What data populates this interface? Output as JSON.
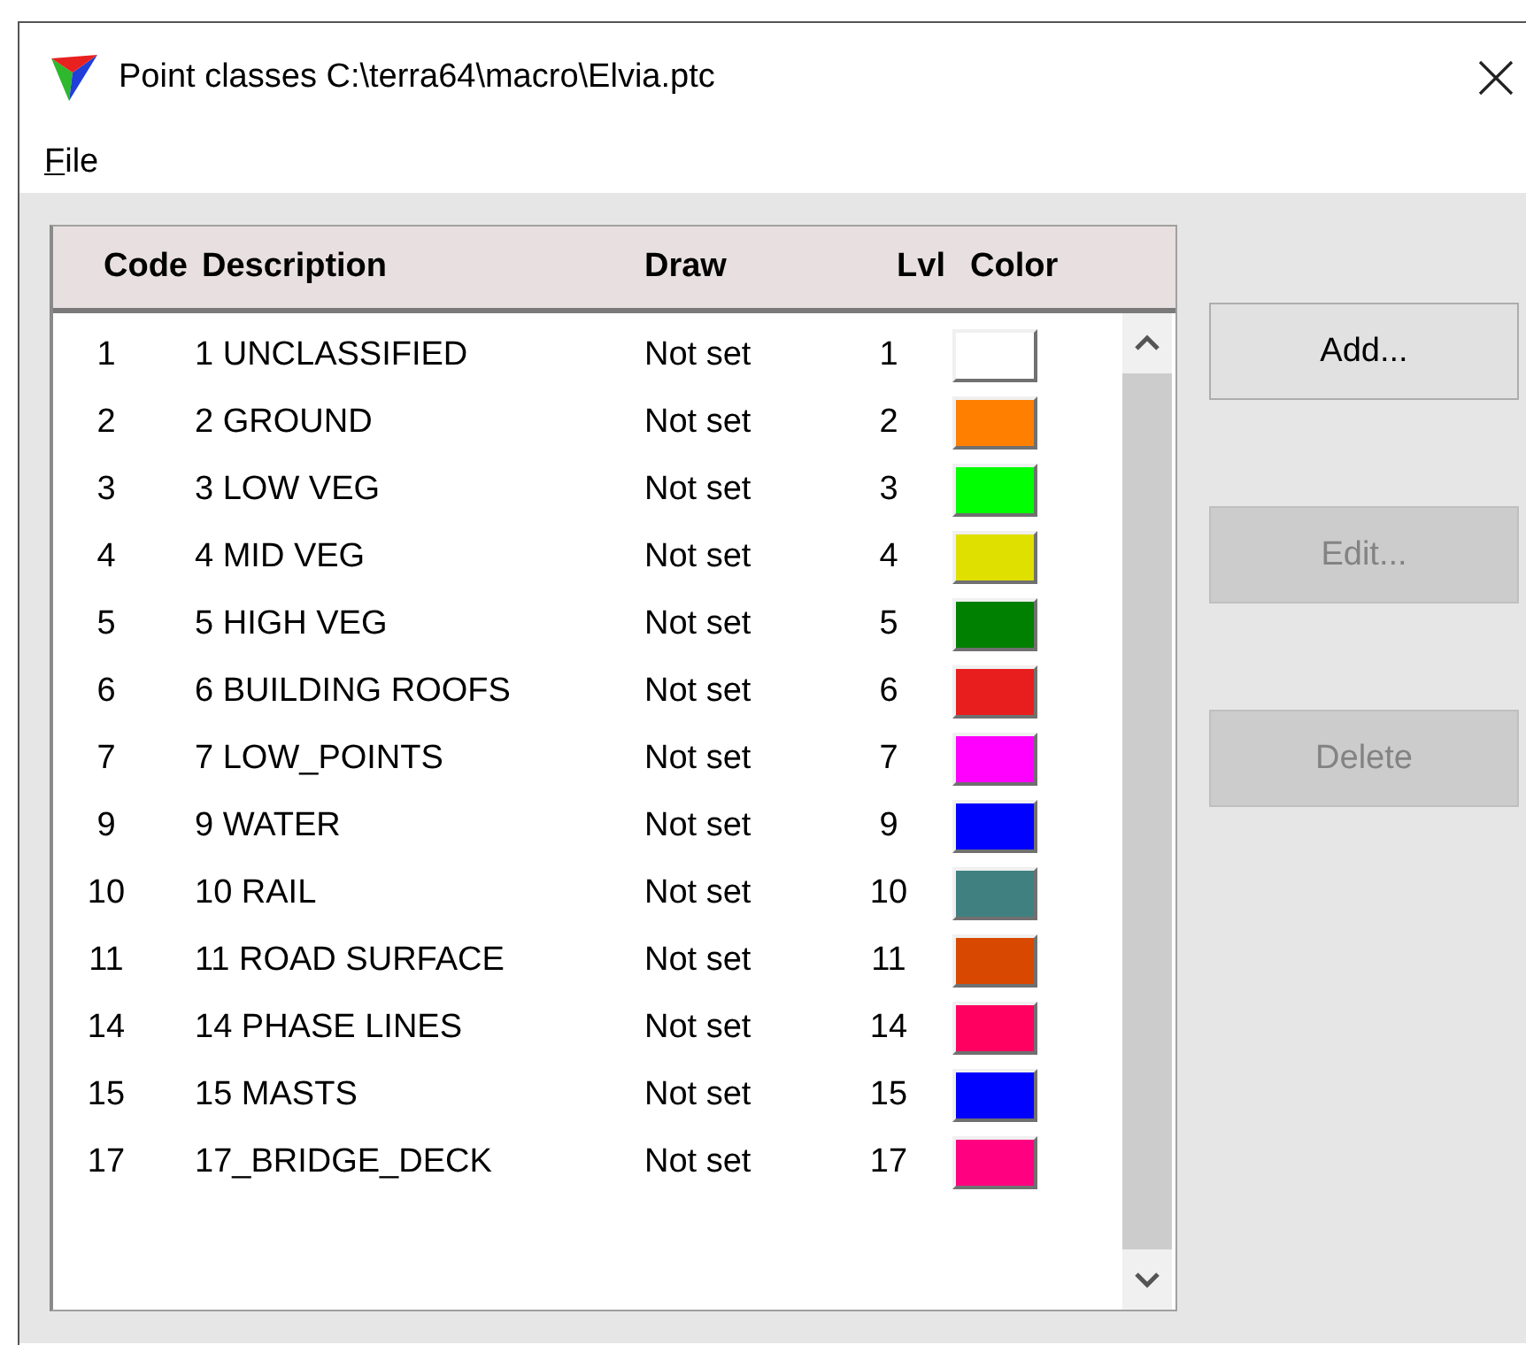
{
  "window": {
    "title": "Point classes C:\\terra64\\macro\\Elvia.ptc"
  },
  "menu": [
    {
      "label": "File"
    }
  ],
  "table": {
    "columns": [
      "Code",
      "Description",
      "Draw",
      "Lvl",
      "Color"
    ],
    "rows": [
      {
        "code": "1",
        "description": "1 UNCLASSIFIED",
        "draw": "Not set",
        "lvl": "1",
        "color": "#ffffff"
      },
      {
        "code": "2",
        "description": "2 GROUND",
        "draw": "Not set",
        "lvl": "2",
        "color": "#ff8000"
      },
      {
        "code": "3",
        "description": "3 LOW VEG",
        "draw": "Not set",
        "lvl": "3",
        "color": "#00ff00"
      },
      {
        "code": "4",
        "description": "4 MID VEG",
        "draw": "Not set",
        "lvl": "4",
        "color": "#e0e000"
      },
      {
        "code": "5",
        "description": "5 HIGH VEG",
        "draw": "Not set",
        "lvl": "5",
        "color": "#008000"
      },
      {
        "code": "6",
        "description": "6 BUILDING ROOFS",
        "draw": "Not set",
        "lvl": "6",
        "color": "#e81e1e"
      },
      {
        "code": "7",
        "description": "7 LOW_POINTS",
        "draw": "Not set",
        "lvl": "7",
        "color": "#ff00ff"
      },
      {
        "code": "9",
        "description": "9 WATER",
        "draw": "Not set",
        "lvl": "9",
        "color": "#0000ff"
      },
      {
        "code": "10",
        "description": "10 RAIL",
        "draw": "Not set",
        "lvl": "10",
        "color": "#408080"
      },
      {
        "code": "11",
        "description": "11 ROAD SURFACE",
        "draw": "Not set",
        "lvl": "11",
        "color": "#d84800"
      },
      {
        "code": "14",
        "description": "14 PHASE LINES",
        "draw": "Not set",
        "lvl": "14",
        "color": "#ff0060"
      },
      {
        "code": "15",
        "description": "15 MASTS",
        "draw": "Not set",
        "lvl": "15",
        "color": "#0000ff"
      },
      {
        "code": "17",
        "description": "17_BRIDGE_DECK",
        "draw": "Not set",
        "lvl": "17",
        "color": "#ff0080"
      }
    ]
  },
  "buttons": [
    {
      "label": "Add...",
      "disabled": false
    },
    {
      "label": "Edit...",
      "disabled": true
    },
    {
      "label": "Delete",
      "disabled": true
    }
  ]
}
